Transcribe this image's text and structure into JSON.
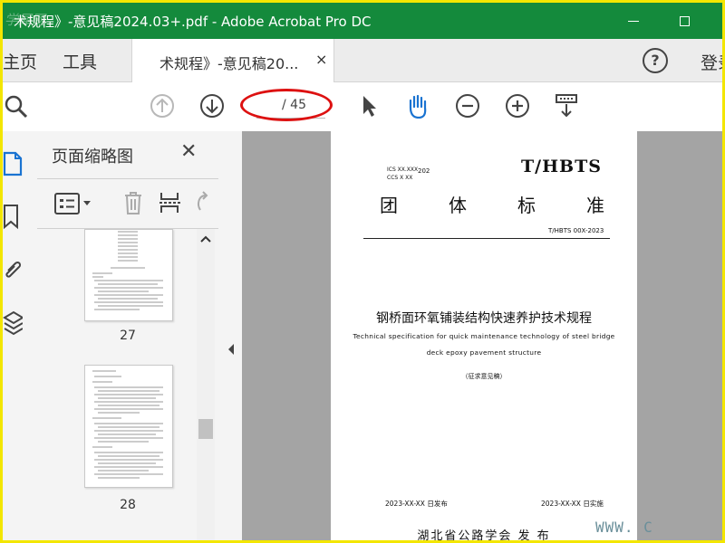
{
  "window": {
    "title": "术规程》-意见稿2024.03+.pdf - Adobe Acrobat Pro DC",
    "watermark": "学犀网"
  },
  "tabbar": {
    "home_label": "主页",
    "tools_label": "工具",
    "doc_tab_label": "术规程》-意见稿20...",
    "close_glyph": "×",
    "help_glyph": "?",
    "signin_label": "登录"
  },
  "toolbar": {
    "page_total": "/ 45"
  },
  "thumbnails_panel": {
    "title": "页面缩略图",
    "close_glyph": "✕",
    "pages": [
      "27",
      "28"
    ]
  },
  "document": {
    "ics_line1": "ICS  XX.XXX",
    "ics_line2": "CCS  X XX",
    "year_code": "202",
    "standard_mark": "T/HBTS",
    "standard_type": [
      "团",
      "体",
      "标",
      "准"
    ],
    "standard_number": "T/HBTS 00X-2023",
    "title_cn": "钢桥面环氧铺装结构快速养护技术规程",
    "title_en_line1": "Technical specification for quick maintenance technology of steel bridge",
    "title_en_line2": "deck epoxy pavement structure",
    "draft_note": "（征求意见稿）",
    "issue_date": "2023-XX-XX 日发布",
    "implement_date": "2023-XX-XX 日实施",
    "publisher": "湖北省公路学会  发 布"
  },
  "watermark_url": "WWW. C"
}
